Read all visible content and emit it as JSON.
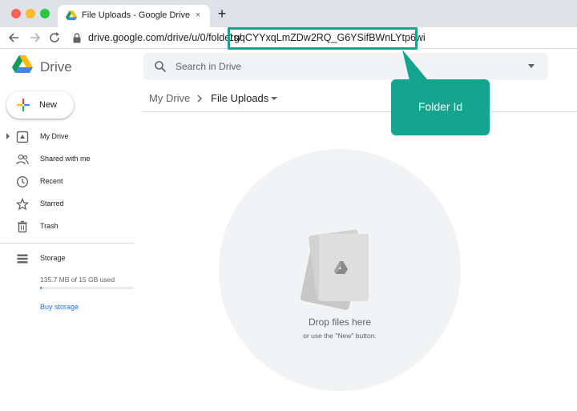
{
  "browser": {
    "tab_title": "File Uploads - Google Drive",
    "tab_close": "×",
    "new_tab": "+",
    "url_prefix": "drive.google.com/drive/u/0/folders/",
    "url_folder_id": "1gqCYYxqLmZDw2RQ_G6YSifBWnLYtp6wi"
  },
  "header": {
    "product_name": "Drive",
    "search_placeholder": "Search in Drive"
  },
  "sidebar": {
    "new_label": "New",
    "items": [
      {
        "label": "My Drive",
        "icon": "my-drive-icon"
      },
      {
        "label": "Shared with me",
        "icon": "shared-with-me-icon"
      },
      {
        "label": "Recent",
        "icon": "clock-icon"
      },
      {
        "label": "Starred",
        "icon": "star-icon"
      },
      {
        "label": "Trash",
        "icon": "trash-icon"
      },
      {
        "label": "Storage",
        "icon": "storage-icon"
      }
    ],
    "storage_used": "135.7 MB of 15 GB used",
    "storage_fraction": 0.009,
    "buy_storage": "Buy storage"
  },
  "main": {
    "breadcrumb_root": "My Drive",
    "breadcrumb_current": "File Uploads",
    "drop_title": "Drop files here",
    "drop_subtitle": "or use the \"New\" button."
  },
  "annotation": {
    "callout_text": "Folder Id",
    "color": "#15a58f"
  }
}
